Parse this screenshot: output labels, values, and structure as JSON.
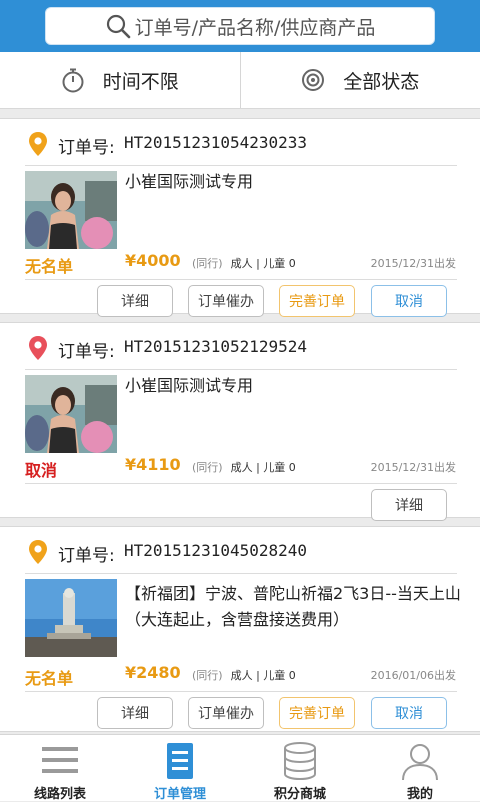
{
  "search": {
    "placeholder": "订单号/产品名称/供应商产品"
  },
  "filters": {
    "time": "时间不限",
    "status": "全部状态"
  },
  "orders": [
    {
      "order_label": "订单号:",
      "order_no": "HT20151231054230233",
      "pin_color": "#f0a21a",
      "title": "小崔国际测试专用",
      "status": "无名单",
      "status_color": "#e89a13",
      "price": "¥4000",
      "tag": "(同行)",
      "meta": "成人 | 儿童 0",
      "date": "2015/12/31出发",
      "buttons": [
        "详细",
        "订单催办",
        "完善订单",
        "取消"
      ]
    },
    {
      "order_label": "订单号:",
      "order_no": "HT20151231052129524",
      "pin_color": "#e8505b",
      "title": "小崔国际测试专用",
      "status": "取消",
      "status_color": "#d62020",
      "price": "¥4110",
      "tag": "(同行)",
      "meta": "成人 | 儿童 0",
      "date": "2015/12/31出发",
      "buttons": [
        "详细"
      ]
    },
    {
      "order_label": "订单号:",
      "order_no": "HT20151231045028240",
      "pin_color": "#f0a21a",
      "title": "【祈福团】宁波、普陀山祈福2飞3日--当天上山（大连起止，含营盘接送费用）",
      "status": "无名单",
      "status_color": "#e89a13",
      "price": "¥2480",
      "tag": "(同行)",
      "meta": "成人 | 儿童 0",
      "date": "2016/01/06出发",
      "buttons": [
        "详细",
        "订单催办",
        "完善订单",
        "取消"
      ]
    }
  ],
  "tabs": [
    {
      "label": "线路列表",
      "icon": "menu-icon"
    },
    {
      "label": "订单管理",
      "icon": "order-doc-icon",
      "active": true
    },
    {
      "label": "积分商城",
      "icon": "database-icon"
    },
    {
      "label": "我的",
      "icon": "user-icon"
    }
  ],
  "colors": {
    "header": "#2f8fd6",
    "accent_orange": "#e89a13",
    "accent_blue": "#2f8fd6"
  }
}
